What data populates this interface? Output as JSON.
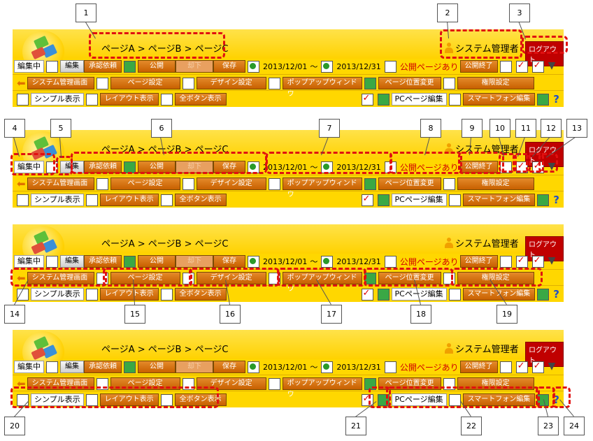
{
  "breadcrumb": "ページA > ページB > ページC",
  "admin_name": "システム管理者",
  "logout_label": "ログアウト",
  "status": "編集中",
  "edit_label": "編集",
  "approval_label": "承認依頼",
  "publish_label": "公開",
  "withdraw_label": "却下",
  "save_label": "保存",
  "date_from": "2013/12/01",
  "tilde": "〜",
  "date_to": "2013/12/31",
  "public_page_label": "公開ページあり",
  "publish_end_label": "公開終了",
  "admin_screen_label": "システム管理画面",
  "page_settings_label": "ページ設定",
  "design_settings_label": "デザイン設定",
  "popup_label": "ポップアップウィンドウ",
  "page_position_label": "ページ位置変更",
  "permission_label": "権限設定",
  "simple_view_label": "シンプル表示",
  "layout_view_label": "レイアウト表示",
  "all_buttons_label": "全ボタン表示",
  "pc_edit_label": "PCページ編集",
  "smartphone_edit_label": "スマートフォン編集",
  "help_glyph": "?",
  "callouts": [
    "1",
    "2",
    "3",
    "4",
    "5",
    "6",
    "7",
    "8",
    "9",
    "10",
    "11",
    "12",
    "13",
    "14",
    "15",
    "16",
    "17",
    "18",
    "19",
    "20",
    "21",
    "22",
    "23",
    "24"
  ],
  "colors": {
    "toolbar": "#ffd700",
    "button": "#d87010",
    "highlight": "#e01010",
    "logout": "#c00000"
  }
}
